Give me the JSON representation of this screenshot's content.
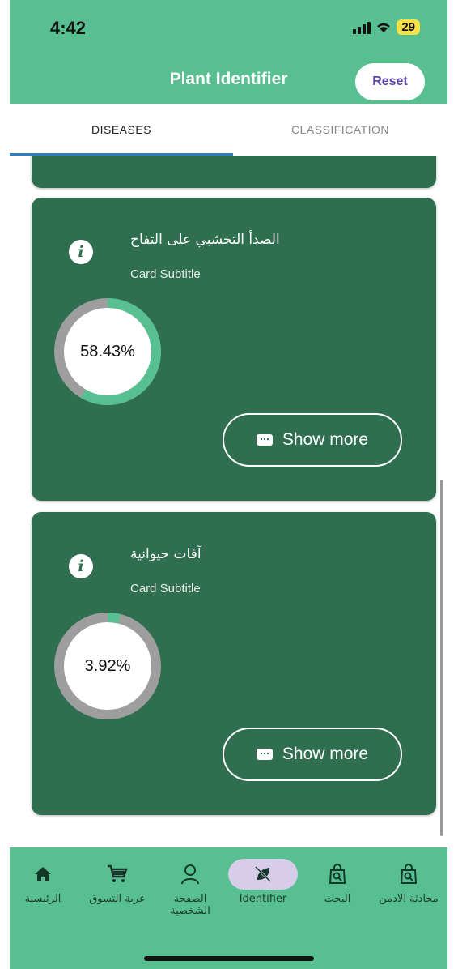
{
  "status": {
    "time": "4:42",
    "battery": "29"
  },
  "header": {
    "title": "Plant Identifier",
    "reset_label": "Reset"
  },
  "tabs": [
    {
      "label": "DISEASES",
      "active": true
    },
    {
      "label": "CLASSIFICATION",
      "active": false
    }
  ],
  "cards": [
    {
      "title": "الصدأ التخشبي على التفاح",
      "subtitle": "Card Subtitle",
      "percent_text": "58.43%",
      "percent_value": 58.43,
      "button_label": "Show more"
    },
    {
      "title": "آفات حيوانية",
      "subtitle": "Card Subtitle",
      "percent_text": "3.92%",
      "percent_value": 3.92,
      "button_label": "Show more"
    }
  ],
  "bottom_nav": [
    {
      "label": "الرئيسية",
      "icon": "home-icon",
      "active": false
    },
    {
      "label": "عربة التسوق",
      "icon": "cart-icon",
      "active": false
    },
    {
      "label": "الصفحة الشخصية",
      "icon": "person-icon",
      "active": false
    },
    {
      "label": "Identifier",
      "icon": "leaf-off-icon",
      "active": true
    },
    {
      "label": "البحث",
      "icon": "search-bag-icon",
      "active": false
    },
    {
      "label": "محادثة الادمن",
      "icon": "admin-chat-icon",
      "active": false
    }
  ],
  "colors": {
    "accent": "#58c090",
    "card": "#2f6f50",
    "progress": "#58c090",
    "track": "#9e9e9e",
    "tab_indicator": "#2f7cc0"
  }
}
